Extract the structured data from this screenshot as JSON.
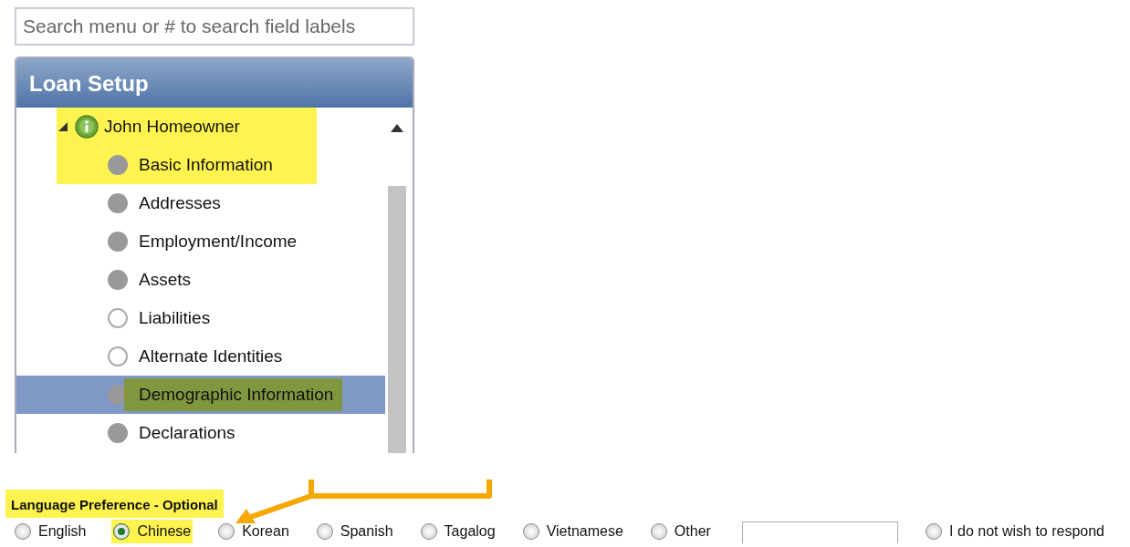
{
  "search": {
    "placeholder": "Search menu or # to search field labels"
  },
  "panel": {
    "title": "Loan Setup",
    "tree": [
      {
        "label": "John Homeowner",
        "expanded": true,
        "highlighted": true,
        "selected": false,
        "children": [
          {
            "label": "Basic Information",
            "filled": true,
            "highlighted": true,
            "selected": false
          },
          {
            "label": "Addresses",
            "filled": true,
            "highlighted": false,
            "selected": false
          },
          {
            "label": "Employment/Income",
            "filled": true,
            "highlighted": false,
            "selected": false
          },
          {
            "label": "Assets",
            "filled": true,
            "highlighted": false,
            "selected": false
          },
          {
            "label": "Liabilities",
            "filled": false,
            "highlighted": false,
            "selected": false
          },
          {
            "label": "Alternate Identities",
            "filled": false,
            "highlighted": false,
            "selected": false
          },
          {
            "label": "Demographic Information",
            "filled": true,
            "highlighted": true,
            "selected": true
          },
          {
            "label": "Declarations",
            "filled": true,
            "highlighted": false,
            "selected": false
          }
        ]
      }
    ]
  },
  "language": {
    "label": "Language Preference - Optional",
    "highlighted": true,
    "options": [
      {
        "kind": "radio",
        "label": "English",
        "selected": false,
        "highlighted": false
      },
      {
        "kind": "radio",
        "label": "Chinese",
        "selected": true,
        "highlighted": true
      },
      {
        "kind": "radio",
        "label": "Korean",
        "selected": false,
        "highlighted": false
      },
      {
        "kind": "radio",
        "label": "Spanish",
        "selected": false,
        "highlighted": false
      },
      {
        "kind": "radio",
        "label": "Tagalog",
        "selected": false,
        "highlighted": false
      },
      {
        "kind": "radio",
        "label": "Vietnamese",
        "selected": false,
        "highlighted": false
      },
      {
        "kind": "radio",
        "label": "Other",
        "selected": false,
        "highlighted": false
      },
      {
        "kind": "field"
      },
      {
        "kind": "radio",
        "label": "I do not wish to respond",
        "selected": false,
        "highlighted": false
      }
    ]
  }
}
